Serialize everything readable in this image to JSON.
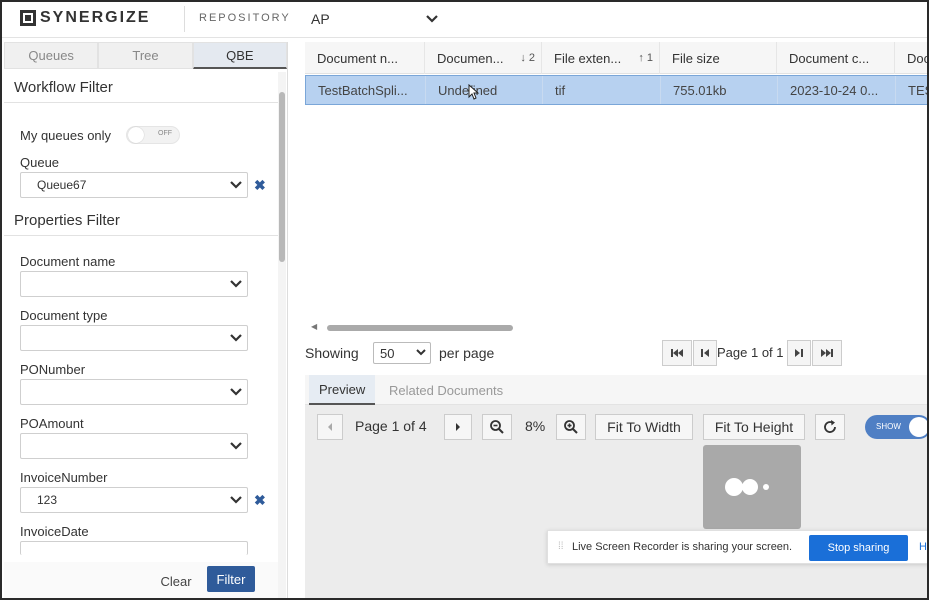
{
  "app": {
    "brand": "SYNERGIZE",
    "repository_label": "REPOSITORY",
    "repository_value": "AP"
  },
  "left_panel": {
    "tabs": [
      {
        "label": "Queues"
      },
      {
        "label": "Tree"
      },
      {
        "label": "QBE"
      }
    ],
    "workflow_filter_title": "Workflow Filter",
    "my_queues_only_label": "My queues only",
    "my_queues_toggle_text": "OFF",
    "queue_label": "Queue",
    "queue_value": "Queue67",
    "properties_filter_title": "Properties Filter",
    "fields": [
      {
        "label": "Document name",
        "value": ""
      },
      {
        "label": "Document type",
        "value": ""
      },
      {
        "label": "PONumber",
        "value": ""
      },
      {
        "label": "POAmount",
        "value": ""
      },
      {
        "label": "InvoiceNumber",
        "value": "123"
      },
      {
        "label": "InvoiceDate",
        "value": ""
      }
    ],
    "clear_label": "Clear",
    "filter_label": "Filter"
  },
  "grid": {
    "columns": [
      {
        "label": "Document n...",
        "sort": ""
      },
      {
        "label": "Documen...",
        "sort": "↓ 2"
      },
      {
        "label": "File exten...",
        "sort": "↑ 1"
      },
      {
        "label": "File size",
        "sort": ""
      },
      {
        "label": "Document c...",
        "sort": ""
      },
      {
        "label": "Doc",
        "sort": ""
      }
    ],
    "rows": [
      {
        "cells": [
          "TestBatchSpli...",
          "Undefined",
          "tif",
          "755.01kb",
          "2023-10-24 0...",
          "TES"
        ]
      }
    ]
  },
  "pager": {
    "showing_label": "Showing",
    "per_page_value": "50",
    "per_page_label": "per page",
    "page_info": "Page 1 of 1"
  },
  "preview": {
    "tabs": [
      {
        "label": "Preview"
      },
      {
        "label": "Related Documents"
      }
    ],
    "page_info": "Page 1 of 4",
    "zoom": "8%",
    "fit_width_label": "Fit To Width",
    "fit_height_label": "Fit To Height",
    "show_toggle_text": "SHOW"
  },
  "share_bar": {
    "message": "Live Screen Recorder is sharing your screen.",
    "stop_label": "Stop sharing",
    "hide_label": "H"
  },
  "colors": {
    "accent": "#2f5b9a",
    "selection": "#b7d1f0",
    "share_button": "#1a6fd8"
  }
}
